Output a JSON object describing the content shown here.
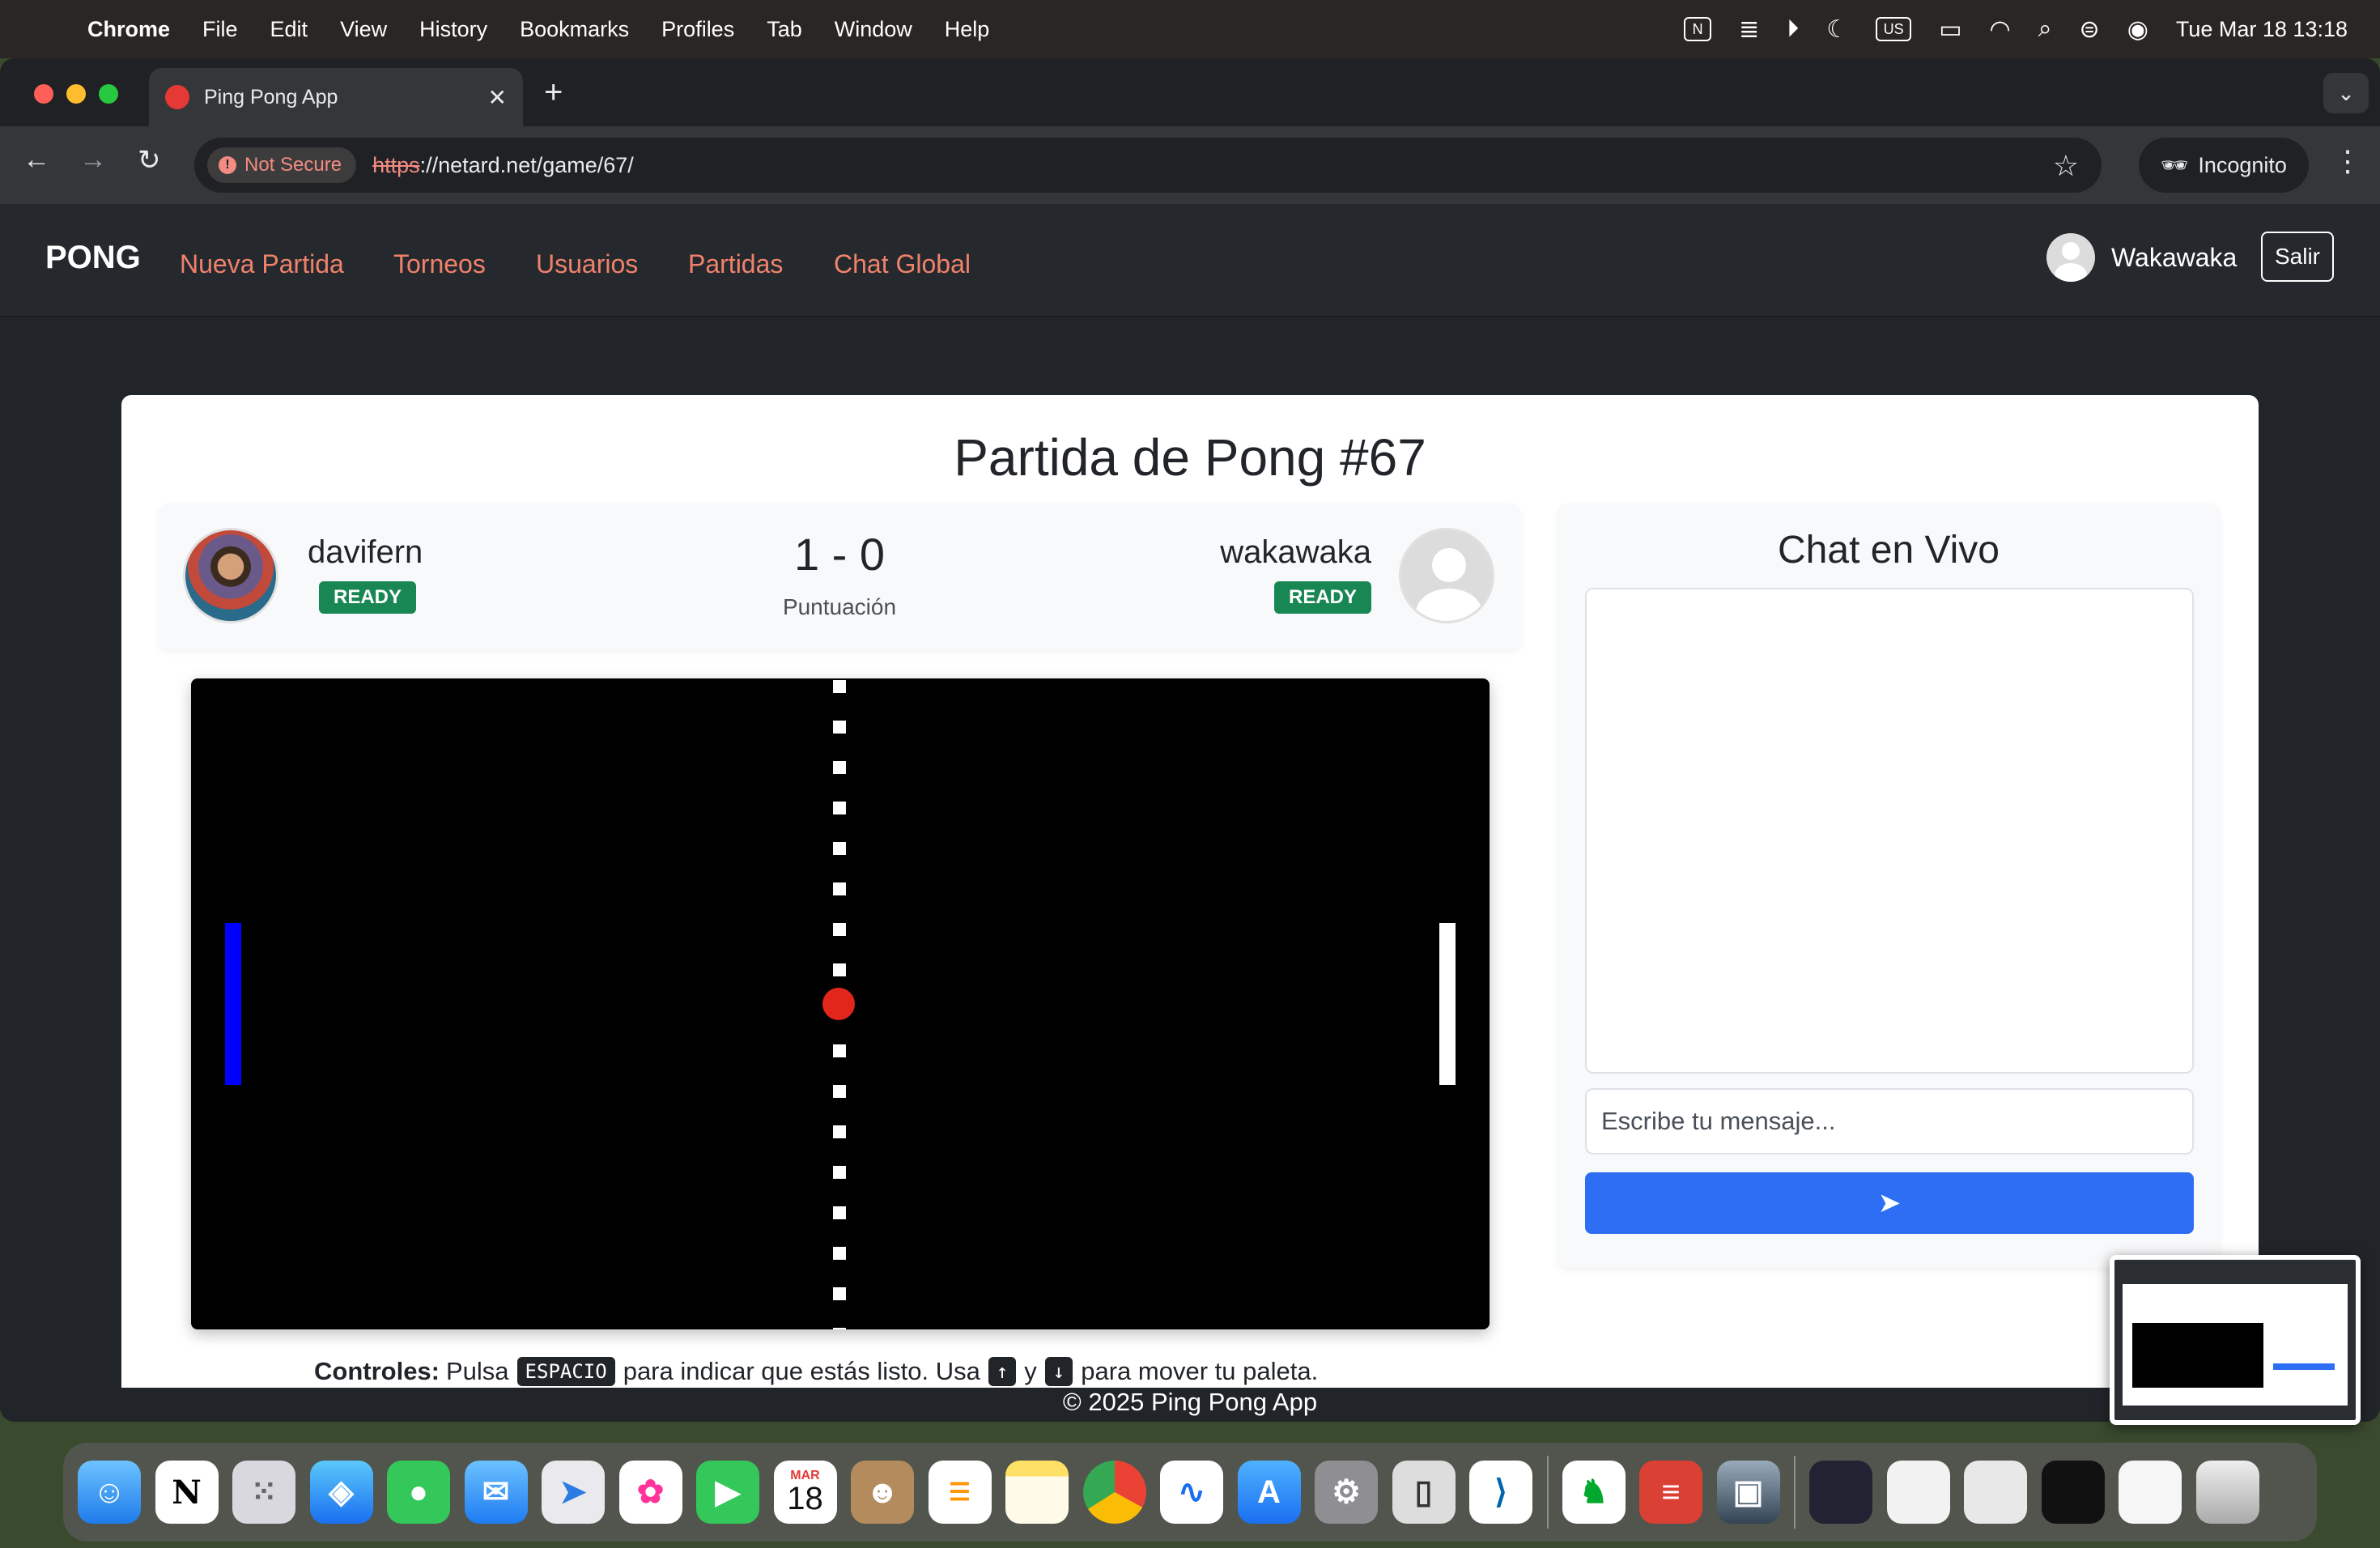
{
  "menubar": {
    "app": "Chrome",
    "items": [
      "File",
      "Edit",
      "View",
      "History",
      "Bookmarks",
      "Profiles",
      "Tab",
      "Window",
      "Help"
    ],
    "status_icons": [
      "notion-icon",
      "stack-icon",
      "play-icon",
      "moon-icon",
      "keyboard-us-icon",
      "battery-icon",
      "wifi-icon",
      "search-icon",
      "control-center-icon",
      "siri-icon"
    ],
    "keyboard_layout": "US",
    "datetime": "Tue Mar 18  13:18"
  },
  "browser": {
    "tab_title": "Ping Pong App",
    "security_label": "Not Secure",
    "url_scheme": "https",
    "url_rest": "://netard.net/game/67/",
    "incognito_label": "Incognito"
  },
  "navbar": {
    "brand": "PONG",
    "links": [
      "Nueva Partida",
      "Torneos",
      "Usuarios",
      "Partidas",
      "Chat Global"
    ],
    "username": "Wakawaka",
    "logout_label": "Salir"
  },
  "game": {
    "title": "Partida de Pong #67",
    "player1": {
      "name": "davifern",
      "status": "READY"
    },
    "player2": {
      "name": "wakawaka",
      "status": "READY"
    },
    "score": "1 - 0",
    "score_label": "Puntuación",
    "colors": {
      "left_paddle": "#0000ff",
      "right_paddle": "#ffffff",
      "ball": "#e3261c",
      "court": "#000000"
    }
  },
  "controls": {
    "label": "Controles:",
    "text1": "Pulsa",
    "key_space": "ESPACIO",
    "text2": "para indicar que estás listo. Usa",
    "key_up": "↑",
    "text3": "y",
    "key_down": "↓",
    "text4": "para mover tu paleta."
  },
  "chat": {
    "title": "Chat en Vivo",
    "placeholder": "Escribe tu mensaje...",
    "send_icon": "paper-plane-icon"
  },
  "footer": "© 2025 Ping Pong App",
  "dock": {
    "calendar_month": "MAR",
    "calendar_day": "18"
  }
}
